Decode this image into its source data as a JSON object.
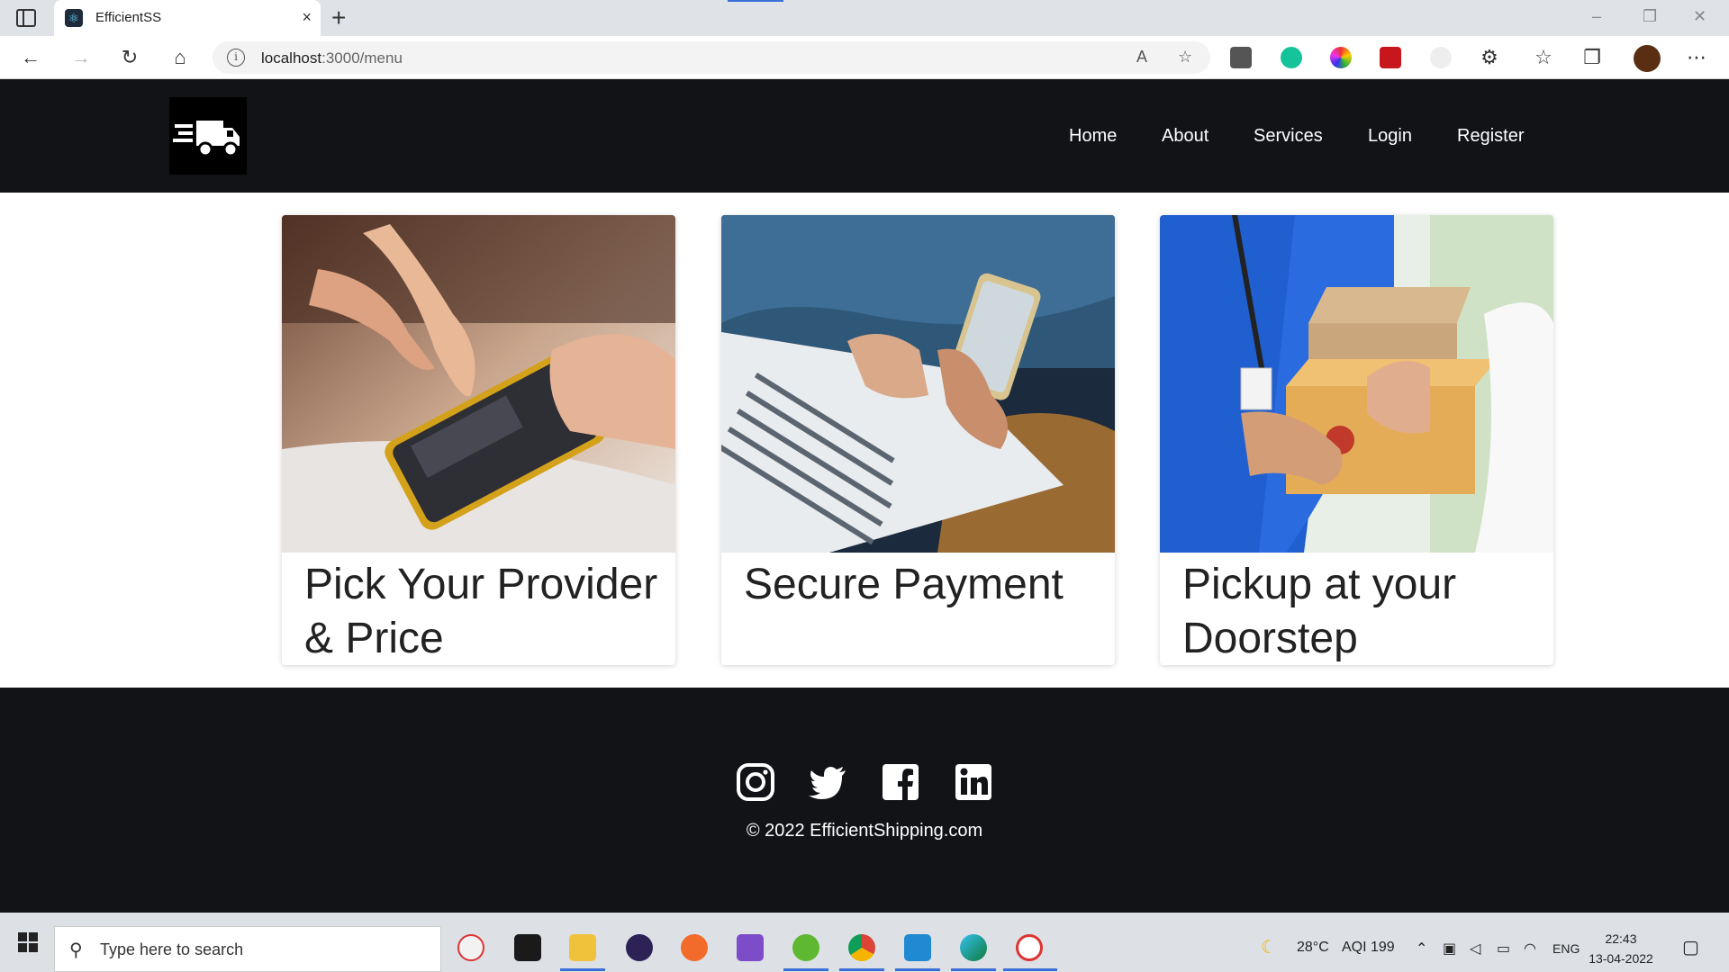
{
  "browser": {
    "tab_title": "EfficientSS",
    "url_host": "localhost",
    "url_path": ":3000/menu",
    "min_icon": "–",
    "restore_icon": "❐",
    "close_icon": "✕"
  },
  "nav": {
    "links": [
      "Home",
      "About",
      "Services",
      "Login",
      "Register"
    ]
  },
  "cards": [
    {
      "title": "Pick Your Provider & Price",
      "image": "hand-tapping-smartphone-photo"
    },
    {
      "title": "Secure Payment",
      "image": "laptop-and-phone-payment-photo"
    },
    {
      "title": "Pickup at your Doorstep",
      "image": "courier-handing-parcels-photo"
    }
  ],
  "footer": {
    "social": [
      "instagram-icon",
      "twitter-icon",
      "facebook-icon",
      "linkedin-icon"
    ],
    "copyright": "© 2022 EfficientShipping.com"
  },
  "taskbar": {
    "search_placeholder": "Type here to search",
    "weather": "28°C",
    "aqi": "AQI 199",
    "lang": "ENG",
    "time": "22:43",
    "date": "13-04-2022"
  },
  "colors": {
    "nav_bg": "#111317",
    "footer_bg": "#111317",
    "accent": "#3a6fd8"
  }
}
